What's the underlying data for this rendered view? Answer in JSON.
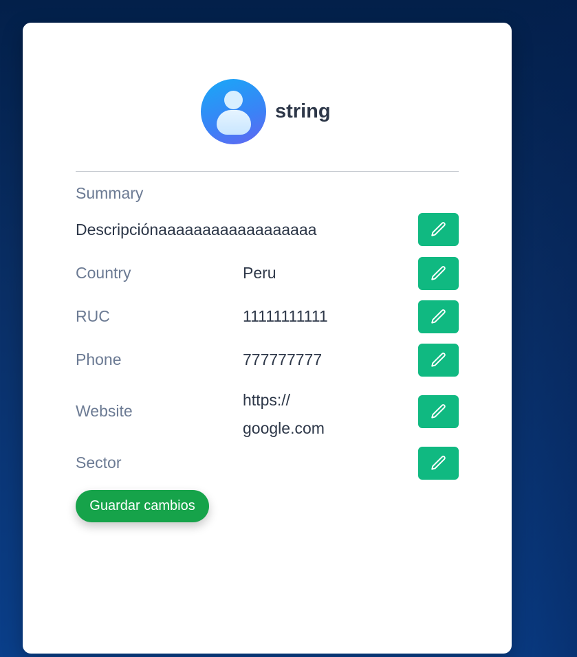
{
  "profile": {
    "username": "string",
    "avatar_icon": "user-avatar-icon"
  },
  "summary": {
    "label": "Summary",
    "value": "Descripciónaaaaaaaaaaaaaaaaaa"
  },
  "fields": {
    "country": {
      "label": "Country",
      "value": "Peru"
    },
    "ruc": {
      "label": "RUC",
      "value": "11111111111"
    },
    "phone": {
      "label": "Phone",
      "value": "777777777"
    },
    "website": {
      "label": "Website",
      "value_line1": "https://",
      "value_line2": "google.com"
    },
    "sector": {
      "label": "Sector",
      "value": ""
    }
  },
  "actions": {
    "edit_icon": "pencil-icon",
    "save_label": "Guardar cambios"
  },
  "colors": {
    "edit_button": "#10b981",
    "save_button": "#16a34a",
    "label_text": "#6b7a93",
    "value_text": "#2d3748"
  }
}
